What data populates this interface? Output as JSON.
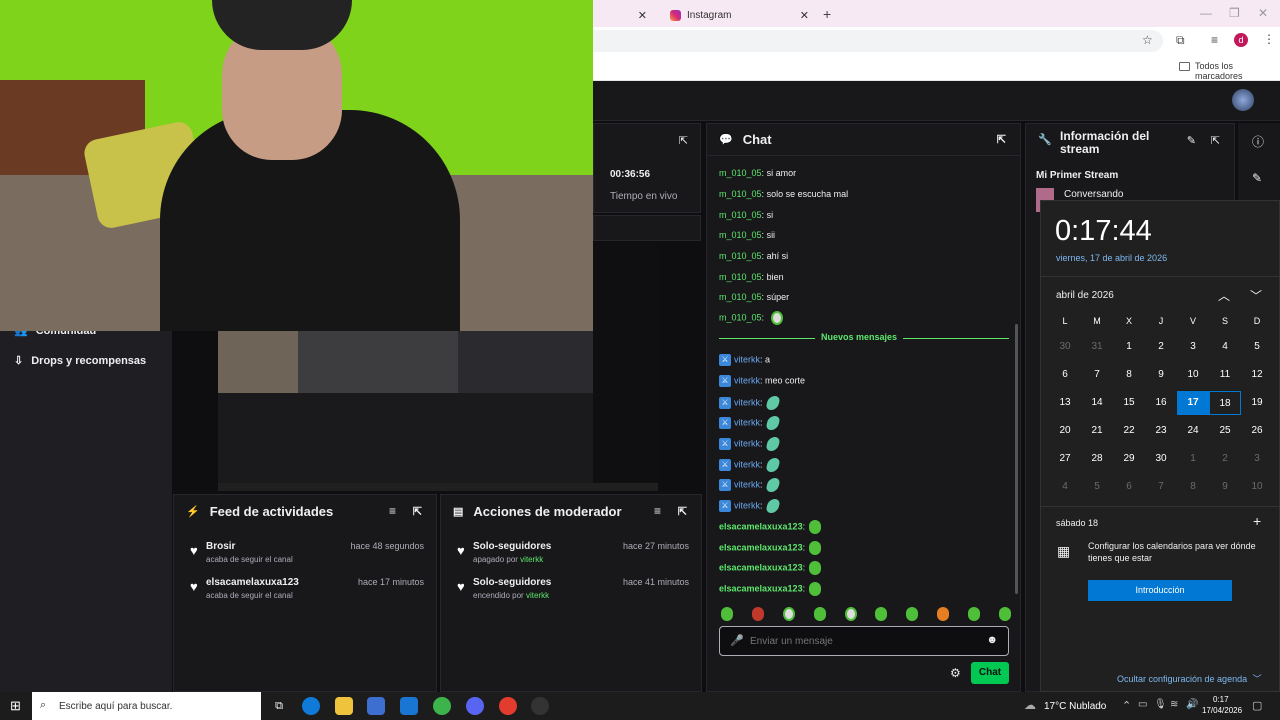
{
  "browser": {
    "tab_label": "Instagram",
    "bookmarks_label": "Todos los marcadores",
    "profile_initial": "d"
  },
  "sidebar": {
    "items": [
      {
        "label": "Comunidad"
      },
      {
        "label": "Drops y recompensas"
      }
    ]
  },
  "stats": {
    "uptime": "00:36:56",
    "uptime_label": "Tiempo en vivo"
  },
  "chat": {
    "title": "Chat",
    "messages": [
      {
        "user": "m_010_05",
        "text": "si amor"
      },
      {
        "user": "m_010_05",
        "text": "solo se escucha mal"
      },
      {
        "user": "m_010_05",
        "text": "si"
      },
      {
        "user": "m_010_05",
        "text": "sii"
      },
      {
        "user": "m_010_05",
        "text": "ahí si"
      },
      {
        "user": "m_010_05",
        "text": "bien"
      },
      {
        "user": "m_010_05",
        "text": "súper"
      },
      {
        "user": "m_010_05",
        "text": ""
      }
    ],
    "new_messages_label": "Nuevos mensajes",
    "new_messages": [
      {
        "user": "viterkk",
        "text": "a"
      },
      {
        "user": "viterkk",
        "text": "meo corte"
      },
      {
        "user": "viterkk",
        "text": ""
      },
      {
        "user": "viterkk",
        "text": ""
      },
      {
        "user": "viterkk",
        "text": ""
      },
      {
        "user": "viterkk",
        "text": ""
      },
      {
        "user": "viterkk",
        "text": ""
      },
      {
        "user": "viterkk",
        "text": ""
      },
      {
        "user": "elsacamelaxuxa123",
        "text": ""
      },
      {
        "user": "elsacamelaxuxa123",
        "text": ""
      },
      {
        "user": "elsacamelaxuxa123",
        "text": ""
      },
      {
        "user": "elsacamelaxuxa123",
        "text": ""
      }
    ],
    "input_placeholder": "Enviar un mensaje",
    "send_label": "Chat"
  },
  "stream_info": {
    "title": "Información del stream",
    "stream_title": "Mi Primer Stream",
    "category": "Conversando"
  },
  "activity_feed": {
    "title": "Feed de actividades",
    "items": [
      {
        "name": "Brosir",
        "desc": "acaba de seguir el canal",
        "time": "hace 48 segundos"
      },
      {
        "name": "elsacamelaxuxa123",
        "desc": "acaba de seguir el canal",
        "time": "hace 17 minutos"
      }
    ]
  },
  "mod_actions": {
    "title": "Acciones de moderador",
    "items": [
      {
        "name": "Solo-seguidores",
        "desc_prefix": "apagado por",
        "moderator": "viterkk",
        "time": "hace 27 minutos"
      },
      {
        "name": "Solo-seguidores",
        "desc_prefix": "encendido por",
        "moderator": "viterkk",
        "time": "hace 41 minutos"
      }
    ]
  },
  "calendar": {
    "time": "0:17:44",
    "date": "viernes, 17 de abril de 2026",
    "month": "abril de 2026",
    "weekdays": [
      "L",
      "M",
      "X",
      "J",
      "V",
      "S",
      "D"
    ],
    "days": [
      "30",
      "31",
      "1",
      "2",
      "3",
      "4",
      "5",
      "6",
      "7",
      "8",
      "9",
      "10",
      "11",
      "12",
      "13",
      "14",
      "15",
      "16",
      "17",
      "18",
      "19",
      "20",
      "21",
      "22",
      "23",
      "24",
      "25",
      "26",
      "27",
      "28",
      "29",
      "30",
      "1",
      "2",
      "3",
      "4",
      "5",
      "6",
      "7",
      "8",
      "9",
      "10"
    ],
    "agenda_day": "sábado 18",
    "agenda_text": "Configurar los calendarios para ver dónde tienes que estar",
    "agenda_button": "Introducción",
    "hide_agenda": "Ocultar configuración de agenda"
  },
  "taskbar": {
    "search_placeholder": "Escribe aquí para buscar.",
    "weather": "17°C  Nublado",
    "clock_time": "0:17",
    "clock_date": "17/04/2026"
  },
  "colors": {
    "accent_green": "#5ce76b",
    "accent_blue": "#6aa8f0",
    "windows_blue": "#0078d4",
    "send_button": "#00c853"
  }
}
